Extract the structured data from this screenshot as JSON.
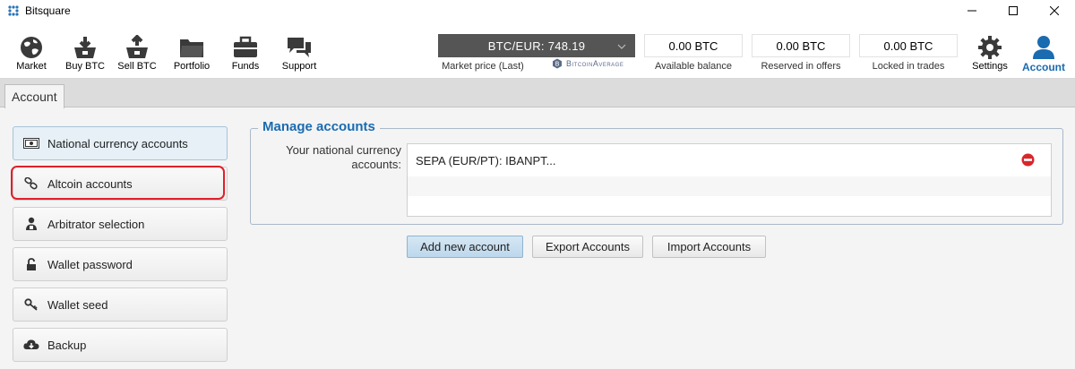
{
  "window": {
    "title": "Bitsquare"
  },
  "toolbar": {
    "items": [
      {
        "label": "Market",
        "icon": "globe-icon"
      },
      {
        "label": "Buy BTC",
        "icon": "buy-btc-icon"
      },
      {
        "label": "Sell BTC",
        "icon": "sell-btc-icon"
      },
      {
        "label": "Portfolio",
        "icon": "folder-icon"
      },
      {
        "label": "Funds",
        "icon": "briefcase-icon"
      },
      {
        "label": "Support",
        "icon": "chat-bubbles-icon"
      }
    ],
    "market_price": {
      "value": "BTC/EUR: 748.19",
      "label": "Market price (Last)",
      "provider": "BitcoinAverage"
    },
    "available_balance": {
      "value": "0.00 BTC",
      "label": "Available balance"
    },
    "reserved_in_offers": {
      "value": "0.00 BTC",
      "label": "Reserved in offers"
    },
    "locked_in_trades": {
      "value": "0.00 BTC",
      "label": "Locked in trades"
    },
    "settings_label": "Settings",
    "account_label": "Account"
  },
  "tabs": [
    {
      "label": "Account",
      "active": true
    }
  ],
  "sidebar": {
    "items": [
      {
        "label": "National currency accounts",
        "icon": "banknote-icon",
        "active": true
      },
      {
        "label": "Altcoin accounts",
        "icon": "link-icon",
        "highlighted": true
      },
      {
        "label": "Arbitrator selection",
        "icon": "arbitrator-icon"
      },
      {
        "label": "Wallet password",
        "icon": "lock-icon"
      },
      {
        "label": "Wallet seed",
        "icon": "key-icon"
      },
      {
        "label": "Backup",
        "icon": "cloud-download-icon"
      }
    ]
  },
  "manage": {
    "title": "Manage accounts",
    "field_label_line1": "Your national currency",
    "field_label_line2": "accounts:",
    "accounts": [
      "SEPA (EUR/PT): IBANPT..."
    ],
    "buttons": {
      "add": "Add new account",
      "export": "Export Accounts",
      "import": "Import Accounts"
    }
  },
  "colors": {
    "accent": "#1a6bb0",
    "highlight": "#e0202a",
    "price_bg": "#555555"
  }
}
